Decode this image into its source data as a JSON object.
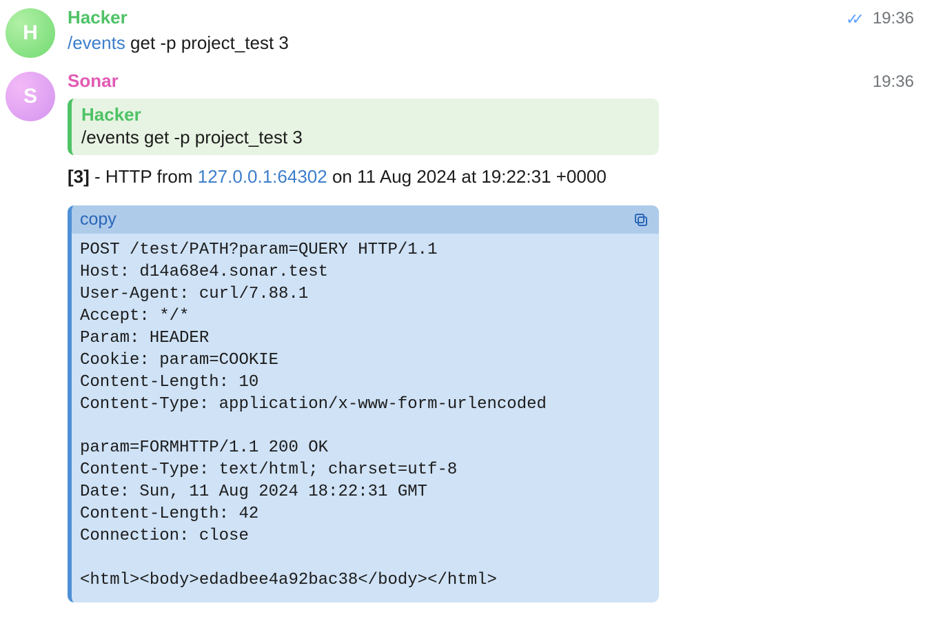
{
  "messages": {
    "m1": {
      "author": "Hacker",
      "avatar_letter": "H",
      "time": "19:36",
      "command_prefix": "/events",
      "command_rest": " get -p project_test 3"
    },
    "m2": {
      "author": "Sonar",
      "avatar_letter": "S",
      "time": "19:36",
      "quote": {
        "author": "Hacker",
        "text": "/events get -p project_test 3"
      },
      "info": {
        "id_bracketed": "[3]",
        "dash_http": " - HTTP from ",
        "ip": "127.0.0.1:64302",
        "tail": " on 11 Aug 2024 at 19:22:31 +0000"
      },
      "code": {
        "copy_label": "copy",
        "content": "POST /test/PATH?param=QUERY HTTP/1.1\nHost: d14a68e4.sonar.test\nUser-Agent: curl/7.88.1\nAccept: */*\nParam: HEADER\nCookie: param=COOKIE\nContent-Length: 10\nContent-Type: application/x-www-form-urlencoded\n\nparam=FORMHTTP/1.1 200 OK\nContent-Type: text/html; charset=utf-8\nDate: Sun, 11 Aug 2024 18:22:31 GMT\nContent-Length: 42\nConnection: close\n\n<html><body>edadbee4a92bac38</body></html>"
      }
    }
  }
}
